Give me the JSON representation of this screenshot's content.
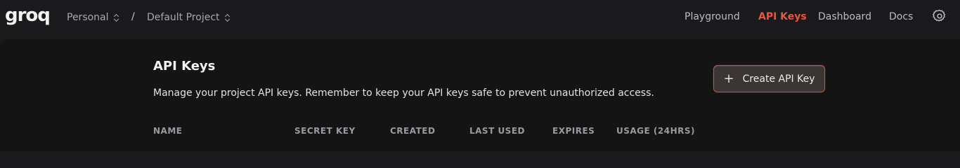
{
  "header": {
    "logo": "groq",
    "org_selector": "Personal",
    "separator": "/",
    "project_selector": "Default Project",
    "nav": [
      {
        "label": "Playground",
        "active": false
      },
      {
        "label": "API Keys",
        "active": true
      },
      {
        "label": "Dashboard",
        "active": false
      },
      {
        "label": "Docs",
        "active": false
      }
    ],
    "settings_icon": "gear-icon",
    "accent_color": "#f0533e"
  },
  "main": {
    "title": "API Keys",
    "description": "Manage your project API keys. Remember to keep your API keys safe to prevent unauthorized access.",
    "create_button": {
      "label": "Create API Key",
      "icon": "plus-icon"
    },
    "table": {
      "columns": [
        "NAME",
        "SECRET KEY",
        "CREATED",
        "LAST USED",
        "EXPIRES",
        "USAGE (24HRS)"
      ]
    }
  }
}
